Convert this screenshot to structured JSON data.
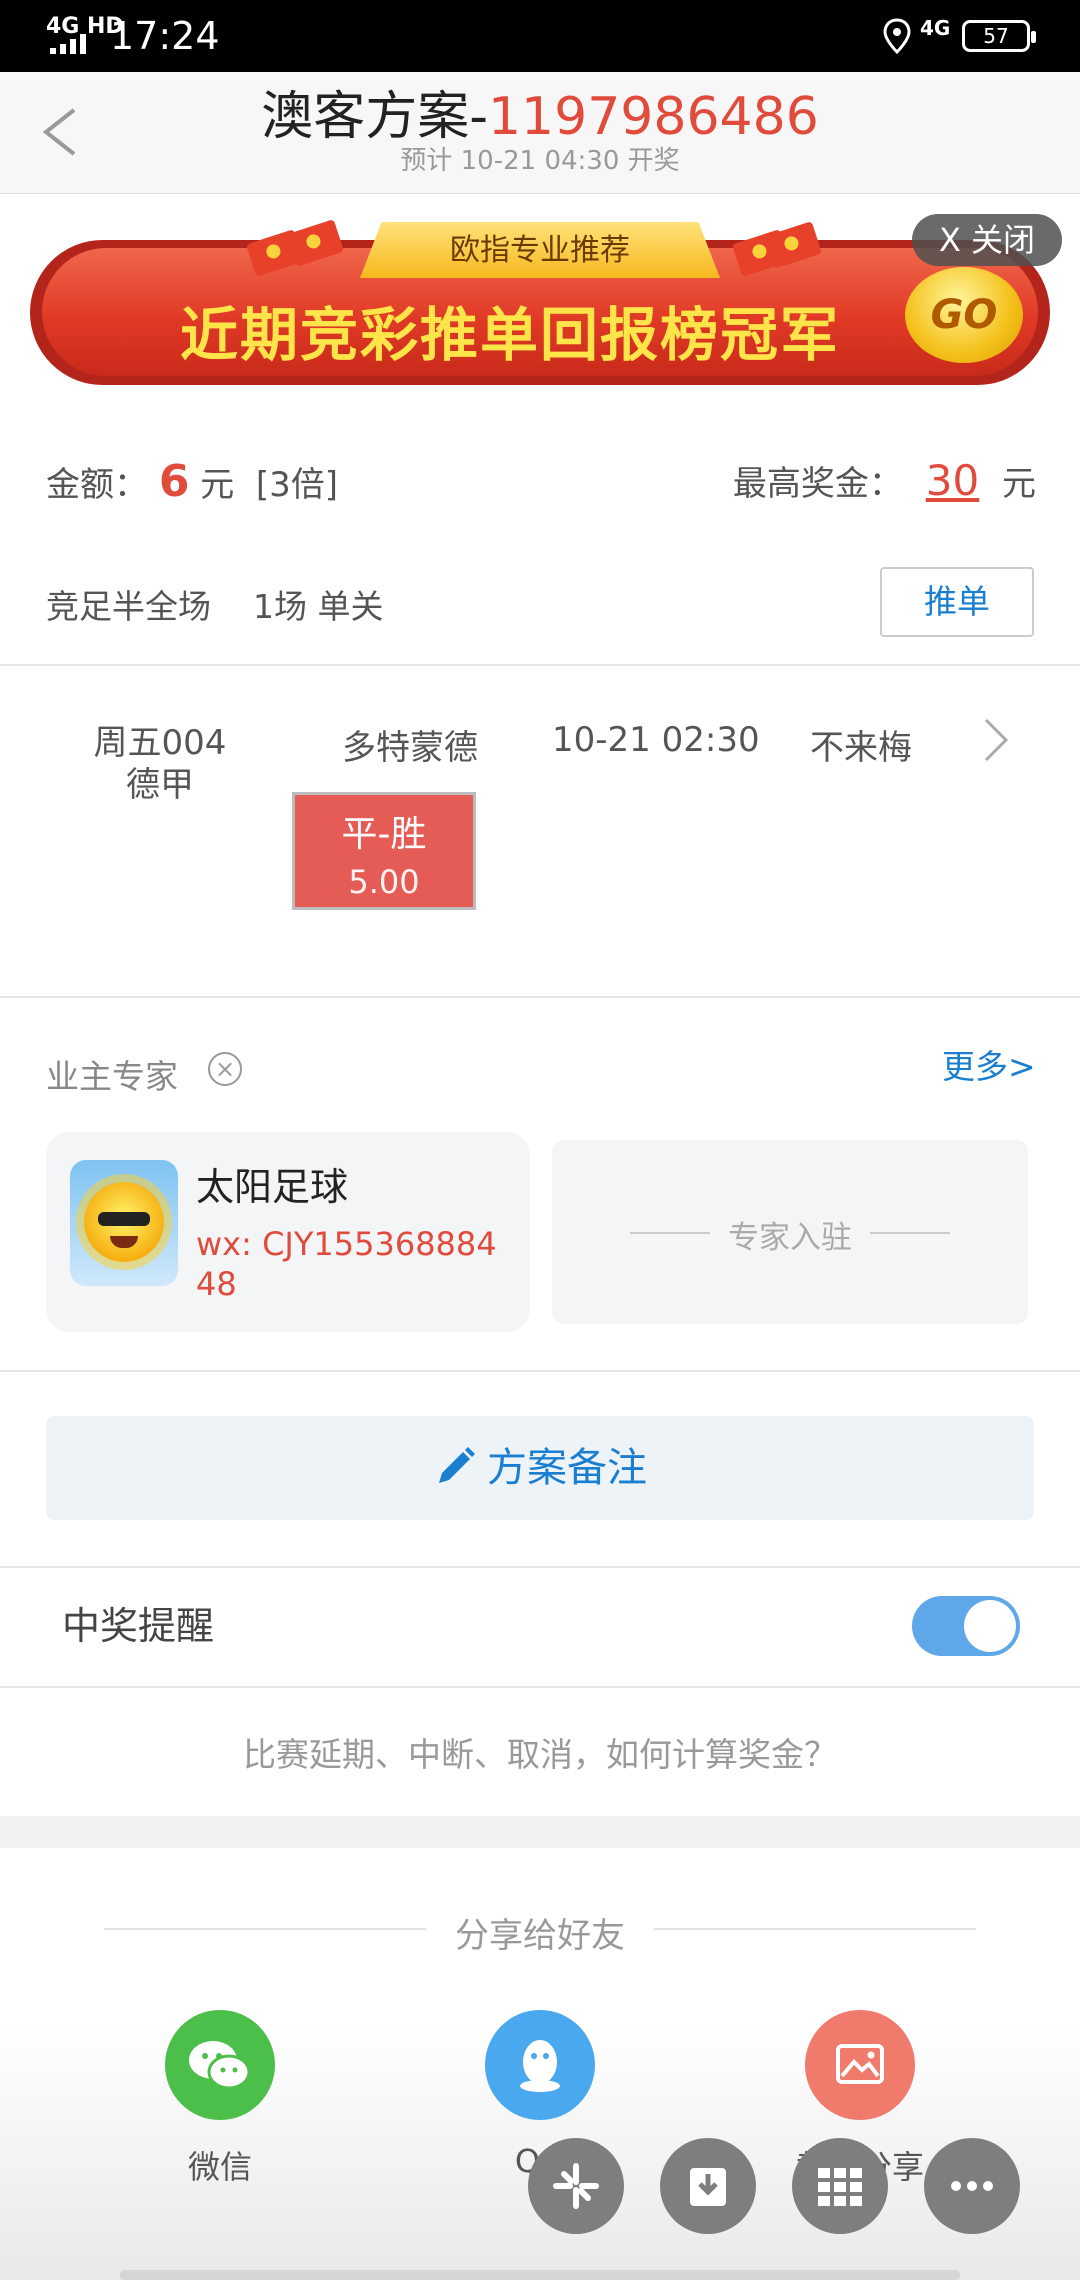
{
  "status_bar": {
    "network": "4G HD",
    "time": "17:24",
    "cell": "4G",
    "battery": "57"
  },
  "header": {
    "title_prefix": "澳客方案-",
    "scheme_id": "1197986486",
    "subtitle": "预计 10-21 04:30 开奖"
  },
  "banner": {
    "tag": "欧指专业推荐",
    "text": "近期竞彩推单回报榜冠军",
    "go": "GO",
    "close_label": "X 关闭"
  },
  "amount": {
    "label": "金额：",
    "value": "6",
    "unit": "元",
    "multiple": "[3倍]",
    "max_label": "最高奖金：",
    "max_value": "30",
    "max_unit": "元"
  },
  "bet": {
    "type": "竞足半全场",
    "matches": "1场 单关",
    "push_label": "推单"
  },
  "match": {
    "code": "周五004",
    "league": "德甲",
    "home": "多特蒙德",
    "time": "10-21 02:30",
    "away": "不来梅",
    "pick_label": "平-胜",
    "pick_odds": "5.00"
  },
  "experts": {
    "section_label": "业主专家",
    "more_label": "更多>",
    "card": {
      "name": "太阳足球",
      "wx": "wx: CJY15536888448"
    },
    "join_label": "专家入驻"
  },
  "note_label": "方案备注",
  "reminder": {
    "label": "中奖提醒",
    "enabled": true
  },
  "faq_label": "比赛延期、中断、取消，如何计算奖金？",
  "share": {
    "title": "分享给好友",
    "items": [
      {
        "label": "微信",
        "color": "#4cbf4a",
        "icon": "wechat-icon"
      },
      {
        "label": "QQ",
        "color": "#4aa8ef",
        "icon": "qq-icon"
      },
      {
        "label": "截图分享",
        "color": "#f07a6c",
        "icon": "image-icon"
      }
    ]
  },
  "colors": {
    "accent_red": "#e04b3c",
    "link_blue": "#1a7fd0",
    "pick_bg": "#e55b55",
    "toggle_on": "#5ea7e8"
  }
}
